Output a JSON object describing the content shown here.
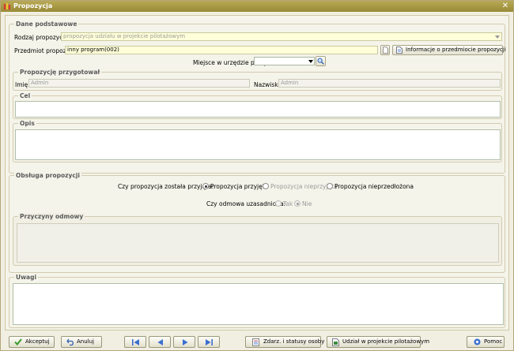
{
  "window": {
    "title": "Propozycja",
    "close_glyph": "✕"
  },
  "basic": {
    "legend": "Dane podstawowe",
    "rodzaj_label": "Rodzaj propozycji",
    "rodzaj_value": "propozycja udziału w projekcie pilotażowym",
    "przedmiot_label": "Przedmiot propozycji",
    "przedmiot_value": "inny program(002)",
    "info_button": "Informacje o przedmiocie propozycji",
    "miejsce_label": "Miejsce w urzędzie pracy",
    "miejsce_value": ""
  },
  "prepared": {
    "legend": "Propozycję przygotował",
    "imie_label": "Imię",
    "imie_value": "Admin",
    "nazwisko_label": "Nazwisko",
    "nazwisko_value": "Admin"
  },
  "cel": {
    "legend": "Cel"
  },
  "opis": {
    "legend": "Opis"
  },
  "handling": {
    "legend": "Obsługa propozycji",
    "accepted_question": "Czy propozycja została przyjęta:",
    "options": [
      {
        "label": "Propozycja przyjęta",
        "checked": true
      },
      {
        "label": "Propozycja nieprzyjęta",
        "checked": false
      },
      {
        "label": "Propozycja nieprzedłożona",
        "checked": false
      }
    ],
    "refusal_question": "Czy odmowa uzasadniona:",
    "refusal_options": [
      {
        "label": "Tak",
        "checked": false
      },
      {
        "label": "Nie",
        "checked": true
      }
    ],
    "reasons_legend": "Przyczyny odmowy"
  },
  "uwagi": {
    "legend": "Uwagi"
  },
  "footer": {
    "accept": "Akceptuj",
    "cancel": "Anuluj",
    "events": "Zdarz. i statusy osoby",
    "pilot": "Udział w projekcie pilotażowym",
    "help": "Pomoc"
  },
  "colors": {
    "title_bar": "#a89a45",
    "accept_check": "#3a9a2a",
    "nav_blue": "#3a6fd0"
  }
}
